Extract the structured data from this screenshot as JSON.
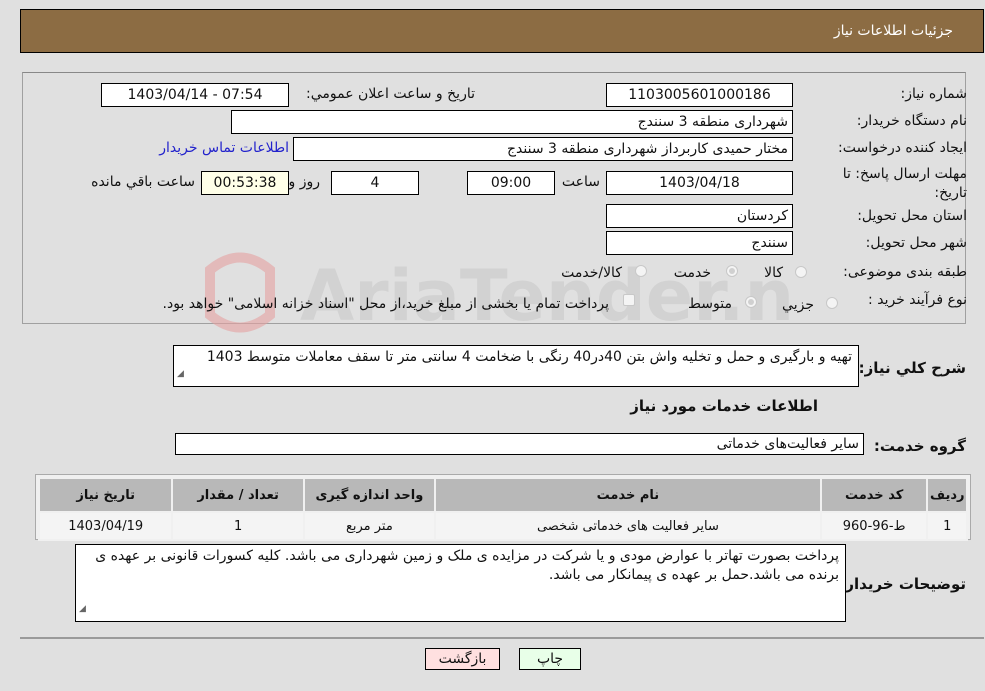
{
  "header": {
    "title": "جزئیات اطلاعات نیاز"
  },
  "fields": {
    "need_number_label": "شماره نیاز:",
    "need_number": "1103005601000186",
    "announce_label": "تاریخ و ساعت اعلان عمومي:",
    "announce_value": "1403/04/14 - 07:54",
    "buyer_org_label": "نام دستگاه خریدار:",
    "buyer_org": "شهرداری منطقه 3 سنندج",
    "creator_label": "ایجاد کننده درخواست:",
    "creator": "مختار حمیدی کاربرداز شهرداری منطقه 3 سنندج",
    "contact_link": "اطلاعات تماس خریدار",
    "deadline_label": "مهلت ارسال پاسخ: تا تاریخ:",
    "deadline_date": "1403/04/18",
    "time_label": "ساعت",
    "deadline_time": "09:00",
    "days_value": "4",
    "days_label": "روز و",
    "remaining_time": "00:53:38",
    "remaining_label": "ساعت باقي مانده",
    "province_label": "استان محل تحویل:",
    "province": "کردستان",
    "city_label": "شهر محل تحویل:",
    "city": "سنندج",
    "category_label": "طبقه بندی موضوعی:",
    "category_options": [
      "کالا",
      "خدمت",
      "کالا/خدمت"
    ],
    "category_selected": "خدمت",
    "process_label": "نوع فرآیند خرید :",
    "process_options": [
      "جزيي",
      "متوسط"
    ],
    "process_selected": "متوسط",
    "treasury_note": "پرداخت تمام یا بخشی از مبلغ خرید،از محل \"اسناد خزانه اسلامی\" خواهد بود."
  },
  "description": {
    "label": "شرح كلي نياز:",
    "value": "تهیه و بارگیری و حمل و تخلیه واش بتن 40در40 رنگی با ضخامت 4 سانتی متر تا سقف معاملات متوسط 1403"
  },
  "services": {
    "section_title": "اطلاعات خدمات مورد نیاز",
    "group_label": "گروه خدمت:",
    "group_value": "سایر فعالیت‌های خدماتی",
    "columns": [
      "ردیف",
      "کد خدمت",
      "نام خدمت",
      "واحد اندازه گیری",
      "تعداد / مقدار",
      "تاریخ نیاز"
    ],
    "rows": [
      [
        "1",
        "ط-96-960",
        "سایر فعالیت های خدماتی شخصی",
        "متر مربع",
        "1",
        "1403/04/19"
      ]
    ]
  },
  "buyer_notes": {
    "label": "توضیحات خریدار:",
    "value": "پرداخت بصورت تهاتر با عوارض مودی و یا شرکت در مزایده ی ملک و زمین شهرداری می باشد. کلیه کسورات قانونی بر عهده ی برنده می باشد.حمل بر عهده ی پیمانکار می باشد."
  },
  "buttons": {
    "print": "چاپ",
    "back": "بازگشت"
  },
  "watermark": {
    "text": "AriaTender.neT"
  },
  "colors": {
    "header_bg": "#8c6c43",
    "back_btn": "#ffe0e0",
    "print_btn": "#e8ffe8",
    "link": "#2222cc"
  }
}
